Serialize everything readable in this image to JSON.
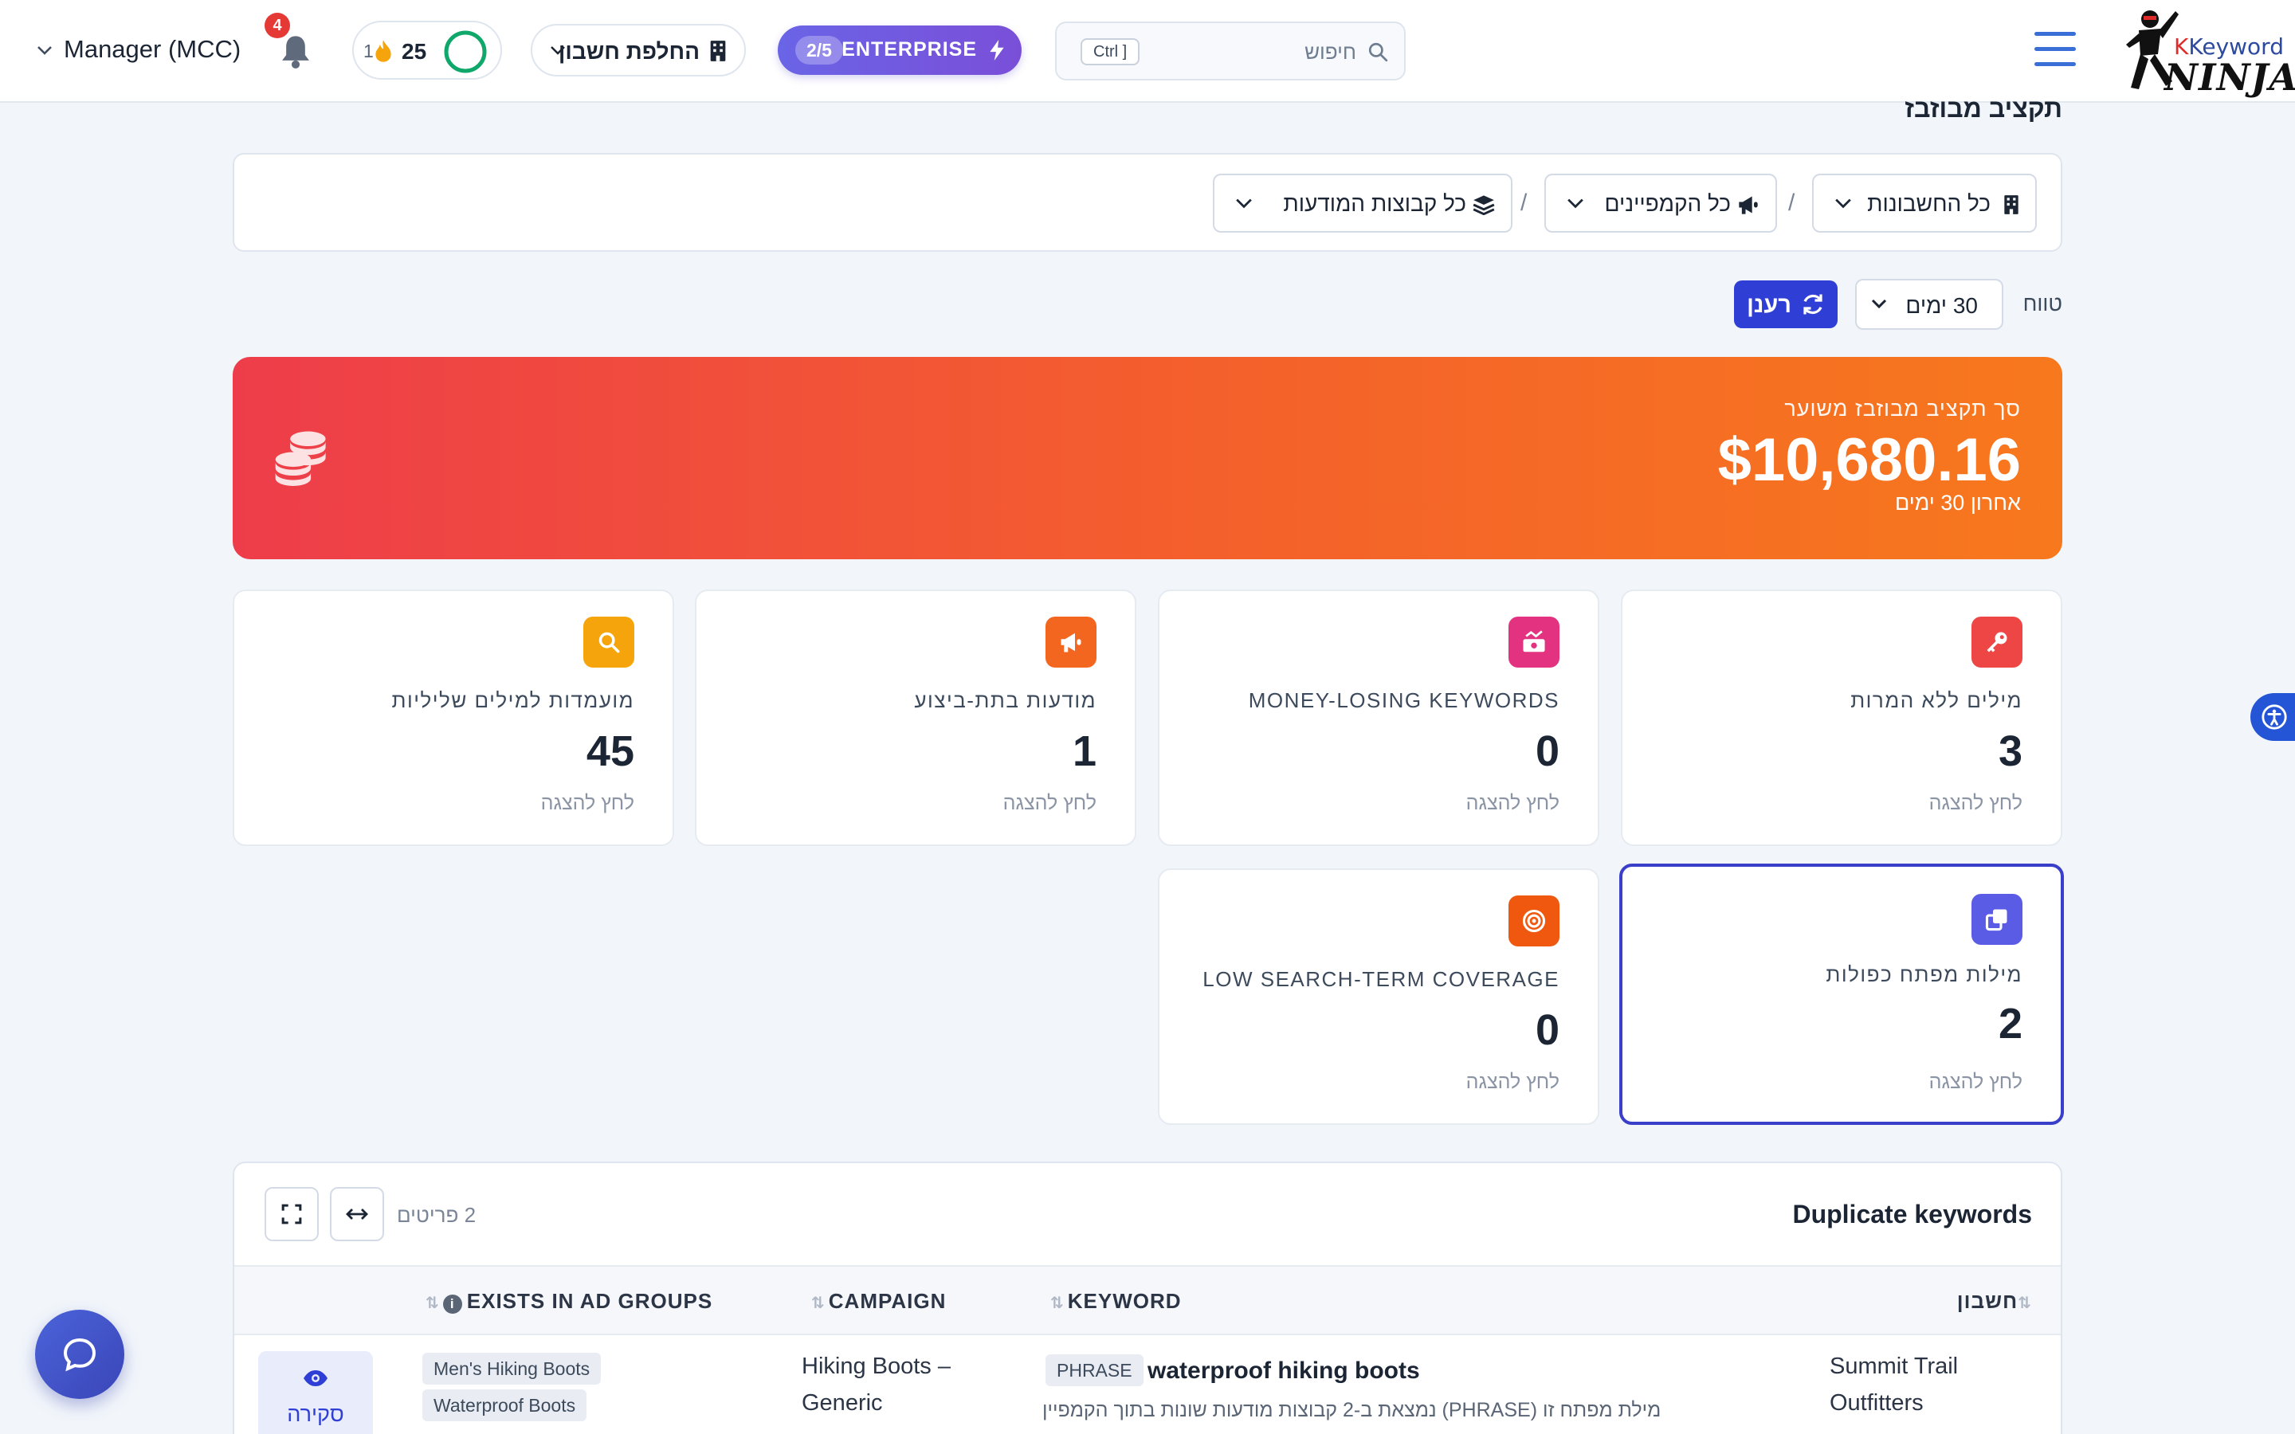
{
  "header": {
    "logo_text": "Keyword",
    "logo_text_2": "NINJA",
    "search_placeholder": "חיפוש",
    "search_shortcut": "Ctrl ]",
    "plan_name": "ENTERPRISE",
    "plan_count": "2/5",
    "switch_account_label": "החלפת חשבון",
    "score": "25",
    "streak": "1",
    "notifications_count": "4",
    "user_label": "Manager (MCC)"
  },
  "page": {
    "title": "תקציב מבוזבז"
  },
  "filters": {
    "accounts": "כל החשבונות",
    "campaigns": "כל הקמפיינים",
    "ad_groups": "כל קבוצות המודעות",
    "separator": "/"
  },
  "range": {
    "label": "טווח",
    "selected": "30 ימים",
    "refresh_label": "רענן"
  },
  "hero": {
    "caption": "סך תקציב מבוזבז משוער",
    "amount": "$10,680.16",
    "subtitle": "אחרון 30 ימים"
  },
  "stats": [
    {
      "title": "מילים ללא המרות",
      "value": "3",
      "hint": "לחץ להצגה",
      "icon": "key-icon",
      "color": "#ee4545"
    },
    {
      "title": "MONEY-LOSING KEYWORDS",
      "value": "0",
      "hint": "לחץ להצגה",
      "icon": "money-icon",
      "color": "#e3327f"
    },
    {
      "title": "מודעות בתת-ביצוע",
      "value": "1",
      "hint": "לחץ להצגה",
      "icon": "megaphone-icon",
      "color": "#f3661f"
    },
    {
      "title": "מועמדות למילים שליליות",
      "value": "45",
      "hint": "לחץ להצגה",
      "icon": "search-icon",
      "color": "#f5a50b"
    },
    {
      "title": "מילות מפתח כפולות",
      "value": "2",
      "hint": "לחץ להצגה",
      "icon": "copy-icon",
      "color": "#5b5ce6"
    },
    {
      "title": "LOW SEARCH-TERM COVERAGE",
      "value": "0",
      "hint": "לחץ להצגה",
      "icon": "target-icon",
      "color": "#f0580f"
    }
  ],
  "table": {
    "title": "Duplicate keywords",
    "count_label": "2 פריטים",
    "headers": {
      "account": "חשבון",
      "keyword": "KEYWORD",
      "campaign": "CAMPAIGN",
      "exists": "EXISTS IN AD GROUPS"
    },
    "rows": [
      {
        "account_line1": "Summit Trail",
        "account_line2": "Outfitters",
        "match_type": "PHRASE",
        "keyword": "waterproof hiking boots",
        "description": "מילת מפתח זו (PHRASE) נמצאת ב-2 קבוצות מודעות שונות בתוך הקמפיין",
        "campaign_line1": "Hiking Boots –",
        "campaign_line2": "Generic",
        "ad_groups": [
          "Men's Hiking Boots",
          "Waterproof Boots"
        ],
        "view_label": "סקירה"
      }
    ]
  }
}
